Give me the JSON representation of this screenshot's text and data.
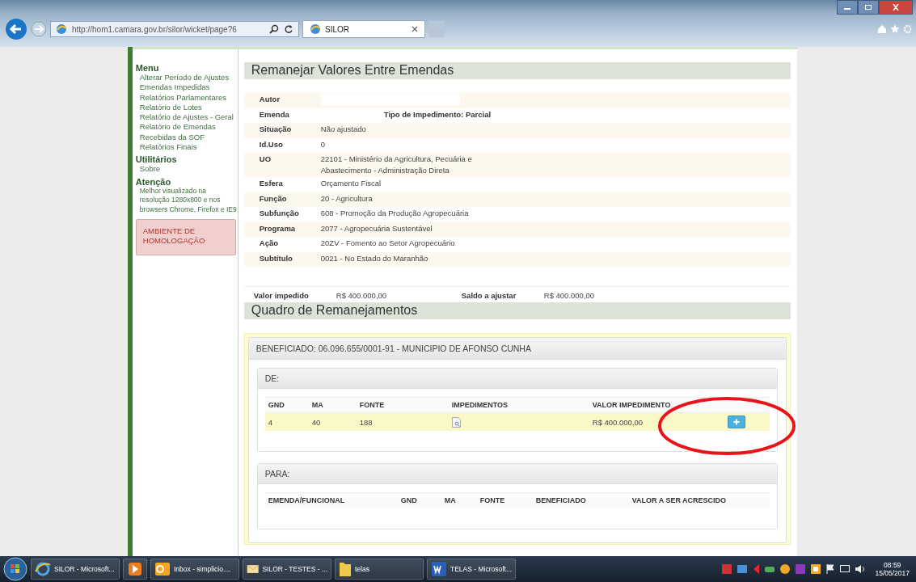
{
  "browser": {
    "url": "http://hom1.camara.gov.br/silor/wicket/page?6",
    "tab_title": "SILOR"
  },
  "sidebar": {
    "sections": [
      {
        "title": "Menu",
        "items": [
          "Alterar Período de Ajustes",
          "Emendas Impedidas",
          "Relatórios Parlamentares",
          "Relatório de Lotes",
          "Relatório de Ajustes - Geral",
          "Relatório de Emendas Recebidas da SOF",
          "Relatórios Finais"
        ]
      },
      {
        "title": "Utilitários",
        "items": [
          "Sobre"
        ]
      }
    ],
    "notice": {
      "title": "Atenção",
      "text": "Melhor visualizado na resolução 1280x800 e nos browsers Chrome, Firefox e IE9"
    },
    "environment": "AMBIENTE DE HOMOLOGAÇÃO"
  },
  "page": {
    "title": "Remanejar Valores Entre Emendas",
    "details": [
      {
        "label": "Autor",
        "kind": "redacted"
      },
      {
        "label": "Emenda",
        "kind": "note",
        "value": "Tipo de Impedimento: Parcial"
      },
      {
        "label": "Situação",
        "kind": "text",
        "value": "Não ajustado"
      },
      {
        "label": "Id.Uso",
        "kind": "text",
        "value": "0"
      },
      {
        "label": "UO",
        "kind": "text",
        "value": "22101 - Ministério da Agricultura, Pecuária e Abastecimento - Administração Direta"
      },
      {
        "label": "Esfera",
        "kind": "text",
        "value": "Orçamento Fiscal"
      },
      {
        "label": "Função",
        "kind": "text",
        "value": "20 - Agricultura"
      },
      {
        "label": "Subfunção",
        "kind": "text",
        "value": "608 - Promoção da Produção Agropecuária"
      },
      {
        "label": "Programa",
        "kind": "text",
        "value": "2077 - Agropecuária Sustentável"
      },
      {
        "label": "Ação",
        "kind": "text",
        "value": "20ZV - Fomento ao Setor Agropecuário"
      },
      {
        "label": "Subtítulo",
        "kind": "text",
        "value": "0021 - No Estado do Maranhão"
      }
    ],
    "summary": [
      {
        "label": "Valor impedido",
        "value": "R$ 400.000,00"
      },
      {
        "label": "Saldo a ajustar",
        "value": "R$ 400.000,00"
      }
    ],
    "section_title": "Quadro de Remanejamentos",
    "beneficiary": "BENEFICIADO: 06.096.655/0001-91 - MUNICIPIO DE AFONSO CUNHA",
    "de": {
      "title": "DE:",
      "columns": [
        "GND",
        "MA",
        "FONTE",
        "IMPEDIMENTOS",
        "VALOR IMPEDIMENTO"
      ],
      "rows": [
        {
          "gnd": "4",
          "ma": "40",
          "fonte": "188",
          "valor": "R$ 400.000,00",
          "highlighted": true
        }
      ]
    },
    "para": {
      "title": "PARA:",
      "columns": [
        "EMENDA/FUNCIONAL",
        "GND",
        "MA",
        "FONTE",
        "BENEFICIADO",
        "VALOR A SER ACRESCIDO"
      ]
    }
  },
  "taskbar": {
    "items": [
      {
        "kind": "ie",
        "label": "SILOR - Microsoft..."
      },
      {
        "kind": "media"
      },
      {
        "kind": "outlook",
        "label": "Inbox - simplicio...."
      },
      {
        "kind": "mail",
        "label": "SILOR - TESTES - ..."
      },
      {
        "kind": "folder",
        "label": "telas"
      },
      {
        "kind": "word",
        "label": "TELAS - Microsoft..."
      }
    ],
    "time": "08:59",
    "date": "15/05/2017"
  }
}
